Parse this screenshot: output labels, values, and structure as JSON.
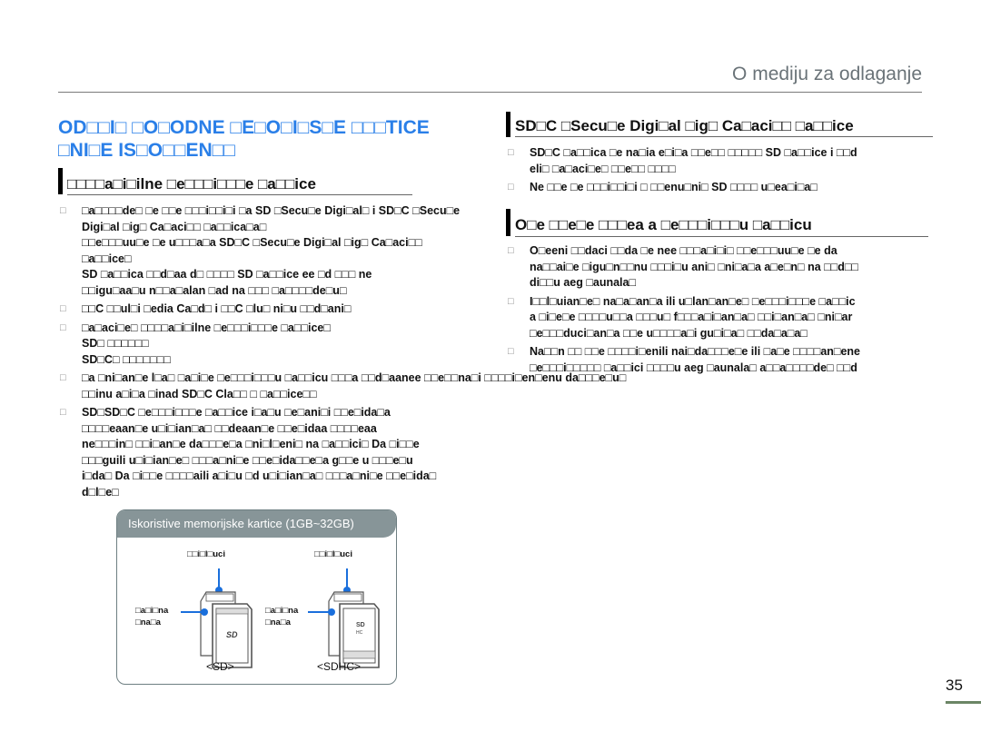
{
  "header": {
    "title": "O mediju za odlaganje"
  },
  "page_title": {
    "line1": "OD□□I□ □O□ODNE □E□O□I□S□E □□□TICE",
    "line2": "□NI□E IS□O□□EN□□"
  },
  "left": {
    "section1": {
      "title": "□□□□a□i□ilne □e□□□i□□□e □a□□ice"
    },
    "bullet_glyph": "□",
    "bullets": [
      {
        "lines": [
          "□a□□□□de□ □e □□e □□□i□□i□i □a SD □Secu□e Digi□al□ i SD□C □Secu□e",
          "Digi□al □ig□ Ca□aci□□ □a□□ica□a□",
          "□□e□□□uu□e □e u□□□a□a SD□C □Secu□e Digi□al □ig□ Ca□aci□□",
          "□a□□ice□",
          "SD □a□□ica □□d□aa d□ □□□□ SD □a□□ice ee □d □□□ ne",
          "□□igu□aa□u n□□a□alan □ad na □□□ □a□□□□de□u□"
        ]
      },
      {
        "lines": [
          "□□C □□ul□i □edia Ca□d□ i □□C □lu□ ni□u □□d□ani□"
        ]
      },
      {
        "lines": [
          "□a□aci□e□ □□□□a□i□ilne □e□□□i□□□e □a□□ice□",
          "SD□ □□□□□□",
          "SD□C□ □□□□□□□"
        ]
      },
      {
        "lines": [
          "□a □ni□an□e l□a□ □a□i□e □e□□□i□□□u □a□□icu □□□a □□d□aanee □□e□□na□i □□□□i□en□enu da□□□e□u□",
          "□□inu a□i□a □inad SD□C Cla□□ □ □a□□ice□□"
        ]
      },
      {
        "lines": [
          "SD□SD□C □e□□□i□□□e □a□□ice i□a□u □e□ani□i □□e□ida□a",
          "□□□□eaan□e u□i□ian□a□ □□deaan□e □□e□idaa □□□□eaa",
          "ne□□□in□ □□i□an□e da□□□e□a □ni□l□eni□ na □a□□ici□ Da □i□□e",
          "□□□guili u□i□ian□e□ □□□a□ni□e □□e□ida□□e□a g□□e u □□□e□u",
          "i□da□ Da □i□□e □□□□aili a□i□u □d u□i□ian□a□ □□□a□ni□e □□e□ida□",
          "d□l□e□"
        ]
      }
    ],
    "panel": {
      "title": "Iskoristive memorijske kartice (1GB~32GB)",
      "label_top": "□□i□l□uci",
      "label_side_1": "□a□i□na",
      "label_side_2": "□na□a",
      "cap_sd": "<SD>",
      "cap_sdhc": "<SDHC>"
    }
  },
  "right": {
    "section1": {
      "title": "SD□C □Secu□e Digi□al □ig□ Ca□aci□□ □a□□ice"
    },
    "s1_bullets": [
      {
        "lines": [
          "SD□C □a□□ica □e na□ia e□i□a □□e□□ □□□□□ SD □a□□ice i □□d",
          "eli□ □a□aci□e□ □□e□□ □□□□"
        ]
      },
      {
        "lines": [
          "Ne □□e □e □□□i□□i□i □ □□enu□ni□ SD □□□□ u□ea□i□a□"
        ]
      }
    ],
    "section2": {
      "title": "O□e □□e□e □□□ea a □e□□□i□□□u □a□□icu"
    },
    "s2_bullets": [
      {
        "lines": [
          "O□eeni □□daci □□da □e nee □□□a□i□i□ □□e□□□uu□e □e da",
          "na□□ai□e □igu□n□□nu □□□i□u ani□ □ni□a□a a□e□n□ na □□d□□",
          "di□□u aeg □aunala□"
        ]
      },
      {
        "lines": [
          "I□□l□uian□e□ na□a□an□a ili u□lan□an□e□ □e□□□i□□□e □a□□ic",
          "a □i□e□e □□□□u□□a □□□u□ f□□□a□i□an□a□ □□i□an□a□ □ni□ar",
          "□e□□□duci□an□a □□e u□□□□a□i gu□i□a□ □□da□a□a□"
        ]
      },
      {
        "lines": [
          "Na□□n □□ □□e □□□□i□enili nai□da□□□e□e ili □a□e □□□□an□ene",
          "□e□□□i□□□□□ □a□□ici □□□□u aeg □aunala□ a□□a□□□□de□ □□d"
        ]
      }
    ]
  },
  "footer": {
    "page_number": "35"
  }
}
